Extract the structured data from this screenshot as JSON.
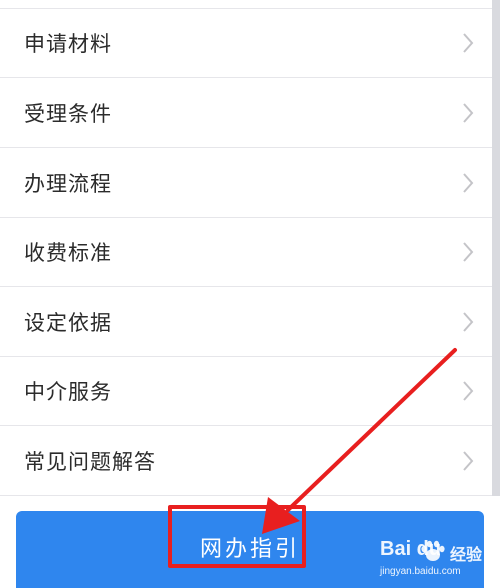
{
  "menu": {
    "items": [
      {
        "label": "申请材料"
      },
      {
        "label": "受理条件"
      },
      {
        "label": "办理流程"
      },
      {
        "label": "收费标准"
      },
      {
        "label": "设定依据"
      },
      {
        "label": "中介服务"
      },
      {
        "label": "常见问题解答"
      }
    ],
    "chevron_icon": "chevron-right-icon"
  },
  "action": {
    "guide_label": "网办指引"
  },
  "watermark": {
    "brand": "Bai du",
    "cn": "经验",
    "url": "jingyan.baidu.com"
  },
  "colors": {
    "button_blue": "#2f86ee",
    "highlight_red": "#e81f1f",
    "text": "#2b2b2b",
    "chevron": "#c4c4c8"
  }
}
